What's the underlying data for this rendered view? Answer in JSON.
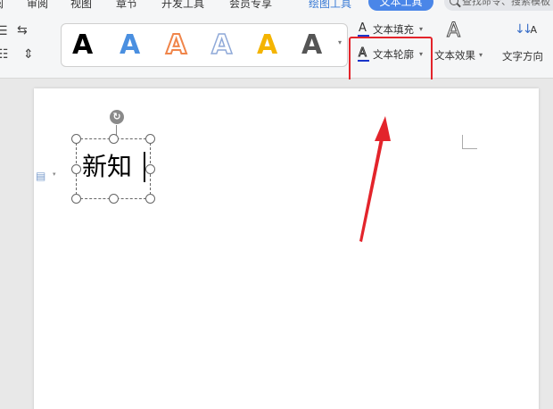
{
  "menubar": {
    "items": [
      "阅",
      "审阅",
      "视图",
      "章节",
      "开发工具",
      "会员专享",
      "绘图工具"
    ],
    "active_tab": "文本工具",
    "search_placeholder": "查找命令、搜索模板"
  },
  "ribbon": {
    "style_gallery": {
      "letters": [
        "A",
        "A",
        "A",
        "A",
        "A",
        "A"
      ],
      "colors": [
        "#000000",
        "#4a8fe0",
        "#f0854a",
        "#8fa9d8",
        "#f4b400",
        "#555555"
      ]
    },
    "text_fill_label": "文本填充",
    "text_outline_label": "文本轮廓",
    "text_effect_label": "文本效果",
    "text_direction_label": "文字方向",
    "text_outline_color": "#1a35c9",
    "text_fill_color": "#1a35c9",
    "highlight_color": "#e3242b"
  },
  "document": {
    "textbox_text": "新知"
  },
  "annotation": {
    "arrow_color": "#e3242b"
  }
}
